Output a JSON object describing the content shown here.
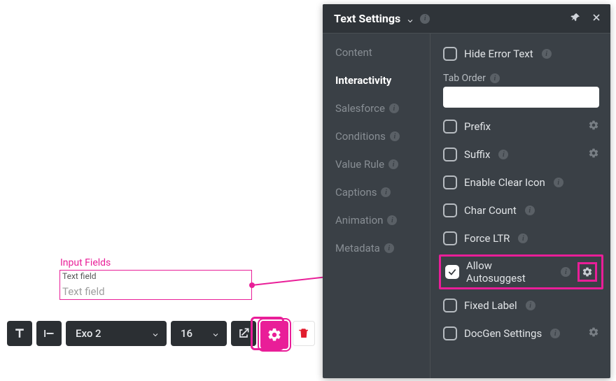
{
  "canvas": {
    "section_title": "Input Fields",
    "textfield_label": "Text field",
    "textfield_placeholder": "Text field"
  },
  "toolbar": {
    "font_family": "Exo 2",
    "font_size": "16"
  },
  "panel": {
    "title": "Text Settings",
    "tabs": {
      "content": "Content",
      "interactivity": "Interactivity",
      "salesforce": "Salesforce",
      "conditions": "Conditions",
      "value_rule": "Value Rule",
      "captions": "Captions",
      "animation": "Animation",
      "metadata": "Metadata"
    },
    "options": {
      "hide_error_text": "Hide Error Text",
      "tab_order_label": "Tab Order",
      "tab_order_value": "",
      "prefix": "Prefix",
      "suffix": "Suffix",
      "enable_clear_icon": "Enable Clear Icon",
      "char_count": "Char Count",
      "force_ltr": "Force LTR",
      "allow_autosuggest": "Allow Autosuggest",
      "fixed_label": "Fixed Label",
      "docgen_settings": "DocGen Settings"
    }
  }
}
